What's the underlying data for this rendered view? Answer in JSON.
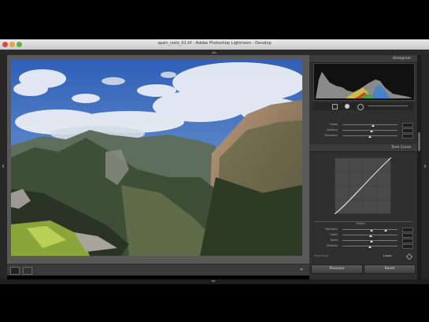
{
  "window": {
    "title": "spain_cielo_01.tif - Adobe Photoshop Lightroom - Develop"
  },
  "panels": {
    "histogram": {
      "title": "Histogram"
    },
    "basic": {
      "sliders": [
        {
          "label": "Clarity",
          "value": 0.53
        },
        {
          "label": "Vibrance",
          "value": 0.5
        },
        {
          "label": "Saturation",
          "value": 0.48
        }
      ]
    },
    "tone_curve": {
      "title": "Tone Curve",
      "region_label": "Region",
      "sliders": [
        {
          "label": "Highlights",
          "value": 0.5,
          "value2": 0.78
        },
        {
          "label": "Lights",
          "value": 0.48
        },
        {
          "label": "Darks",
          "value": 0.5
        },
        {
          "label": "Shadows",
          "value": 0.47
        }
      ],
      "point_curve_value": "Linear",
      "point_curve_label": "Point Curve"
    }
  },
  "buttons": {
    "previous": "Previous",
    "reset": "Reset"
  },
  "colors": {
    "panel": "#2f2f2f",
    "accent_blue": "#3d7fd6"
  }
}
